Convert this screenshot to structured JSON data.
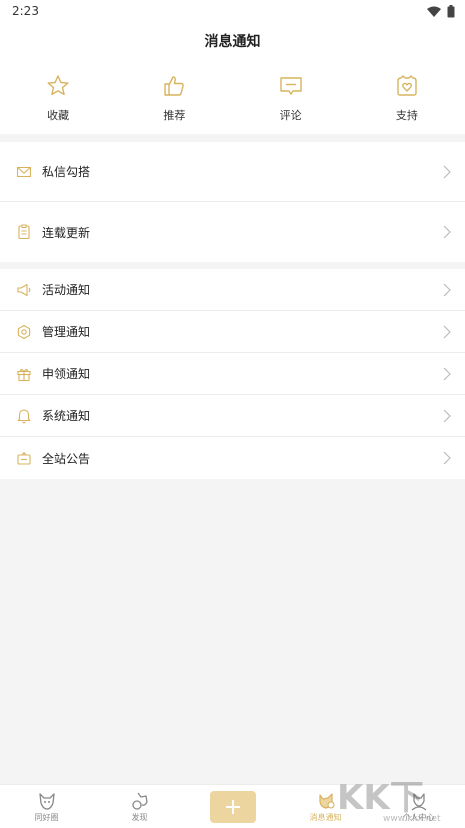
{
  "status_bar": {
    "time": "2:23",
    "wifi_icon": "wifi-icon",
    "battery_icon": "battery-icon"
  },
  "header": {
    "title": "消息通知"
  },
  "quick_actions": [
    {
      "label": "收藏",
      "icon": "star-icon"
    },
    {
      "label": "推荐",
      "icon": "thumbs-up-icon"
    },
    {
      "label": "评论",
      "icon": "comment-icon"
    },
    {
      "label": "支持",
      "icon": "heart-gift-icon"
    }
  ],
  "group1": [
    {
      "label": "私信勾搭",
      "icon": "mail-icon"
    },
    {
      "label": "连载更新",
      "icon": "document-icon"
    }
  ],
  "group2": [
    {
      "label": "活动通知",
      "icon": "megaphone-icon"
    },
    {
      "label": "管理通知",
      "icon": "hexagon-settings-icon"
    },
    {
      "label": "申领通知",
      "icon": "gift-icon"
    },
    {
      "label": "系统通知",
      "icon": "bell-icon"
    },
    {
      "label": "全站公告",
      "icon": "announcement-icon"
    }
  ],
  "tabbar": [
    {
      "label": "同好圈",
      "icon": "fox-icon",
      "active": false
    },
    {
      "label": "发现",
      "icon": "fox-discover-icon",
      "active": false
    },
    {
      "label": "",
      "icon": "plus-icon",
      "active": false
    },
    {
      "label": "消息通知",
      "icon": "fox-bell-icon",
      "active": true
    },
    {
      "label": "个人中心",
      "icon": "fox-person-icon",
      "active": false
    }
  ],
  "watermark": {
    "main": "KK下载",
    "sub": "www.kkx.net"
  },
  "colors": {
    "accent": "#d7b35f",
    "plus_button": "#ecd59f",
    "background": "#f4f4f4"
  }
}
